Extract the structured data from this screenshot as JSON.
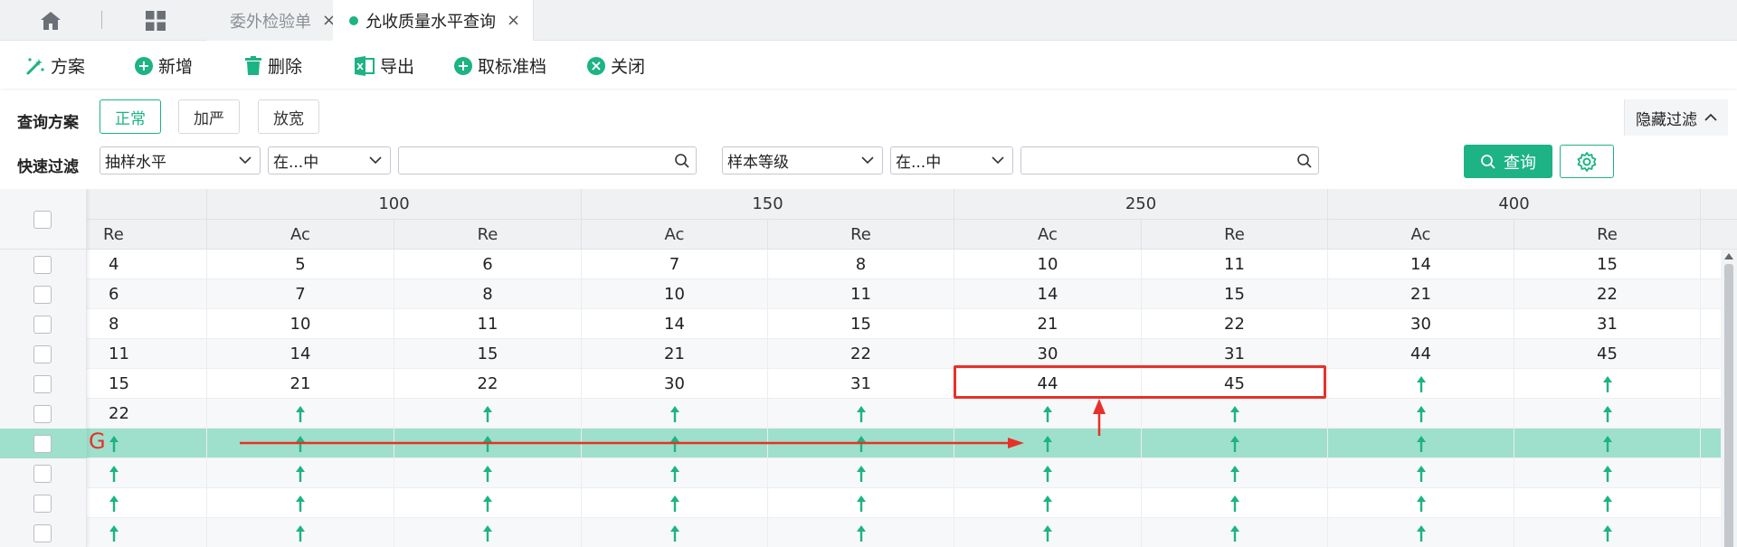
{
  "tabs": [
    {
      "label": "委外检验单",
      "close": "×",
      "active": false
    },
    {
      "label": "允收质量水平查询",
      "close": "×",
      "active": true
    }
  ],
  "toolbar": {
    "plan": "方案",
    "add": "新增",
    "delete": "删除",
    "export": "导出",
    "cancel_std": "取标准档",
    "close": "关闭"
  },
  "filters": {
    "plan_label": "查询方案",
    "plan_options": [
      "正常",
      "加严",
      "放宽"
    ],
    "hide_filter": "隐藏过滤",
    "quick_label": "快速过滤",
    "field1": "抽样水平",
    "op1": "在...中",
    "field2": "样本等级",
    "op2": "在...中",
    "query": "查询"
  },
  "grid": {
    "groups": [
      "100",
      "150",
      "250",
      "400"
    ],
    "subheaders": [
      "Re",
      "Ac",
      "Re",
      "Ac",
      "Re",
      "Ac",
      "Re",
      "Ac",
      "Re"
    ],
    "up_arrow_symbol": "↑",
    "rows": [
      [
        "4",
        "5",
        "6",
        "7",
        "8",
        "10",
        "11",
        "14",
        "15"
      ],
      [
        "6",
        "7",
        "8",
        "10",
        "11",
        "14",
        "15",
        "21",
        "22"
      ],
      [
        "8",
        "10",
        "11",
        "14",
        "15",
        "21",
        "22",
        "30",
        "31"
      ],
      [
        "11",
        "14",
        "15",
        "21",
        "22",
        "30",
        "31",
        "44",
        "45"
      ],
      [
        "15",
        "21",
        "22",
        "30",
        "31",
        "44",
        "45",
        "↑",
        "↑"
      ],
      [
        "22",
        "↑",
        "↑",
        "↑",
        "↑",
        "↑",
        "↑",
        "↑",
        "↑"
      ],
      [
        "↑",
        "↑",
        "↑",
        "↑",
        "↑",
        "↑",
        "↑",
        "↑",
        "↑"
      ],
      [
        "↑",
        "↑",
        "↑",
        "↑",
        "↑",
        "↑",
        "↑",
        "↑",
        "↑"
      ],
      [
        "↑",
        "↑",
        "↑",
        "↑",
        "↑",
        "↑",
        "↑",
        "↑",
        "↑"
      ],
      [
        "↑",
        "↑",
        "↑",
        "↑",
        "↑",
        "↑",
        "↑",
        "↑",
        "↑"
      ]
    ],
    "highlight_row": 6,
    "annotation_label": "G",
    "colors": {
      "accent": "#1db384",
      "highlight": "#9ee0cb",
      "annotation": "#e8302a"
    }
  }
}
